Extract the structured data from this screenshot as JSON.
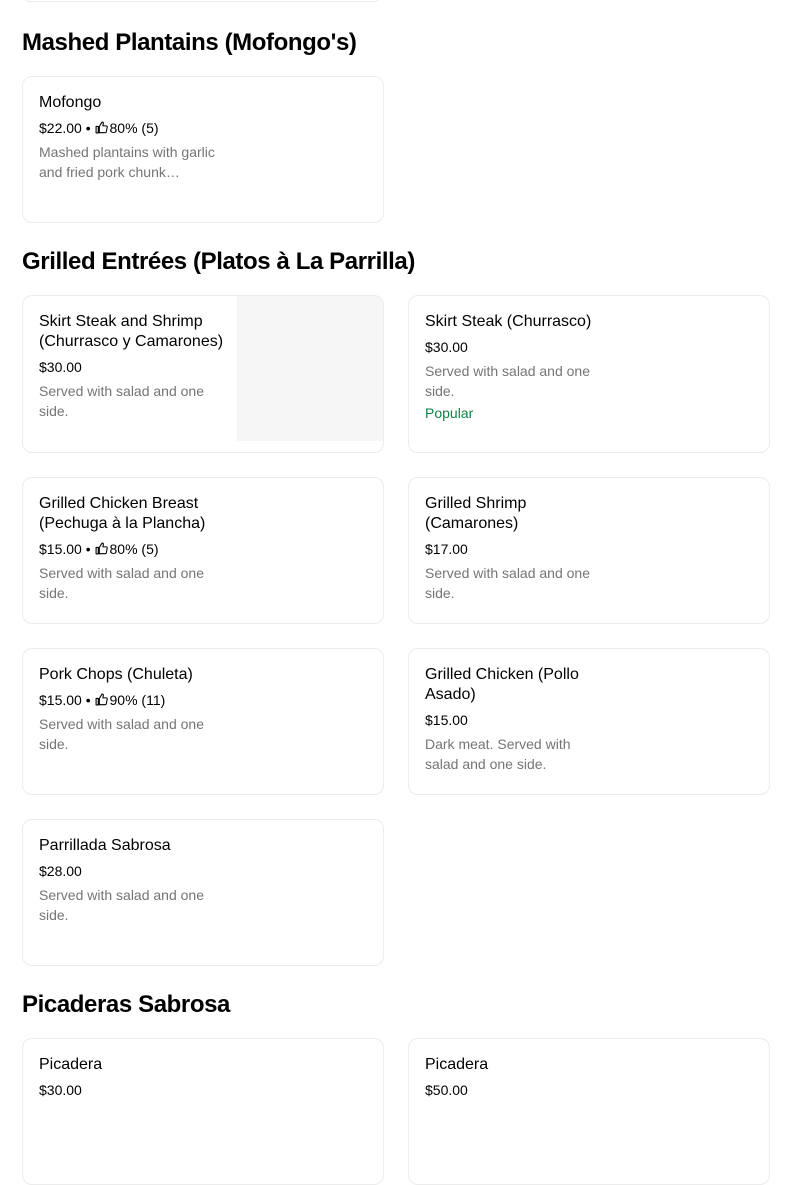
{
  "sections": [
    {
      "title": "Mashed Plantains (Mofongo's)",
      "items": [
        {
          "name": "Mofongo",
          "price": "$22.00",
          "rating": "80% (5)",
          "description": "Mashed plantains with garlic and fried pork chunk…",
          "badge": ""
        }
      ]
    },
    {
      "title": "Grilled Entrées (Platos à La Parrilla)",
      "items": [
        {
          "name": "Skirt Steak and Shrimp (Churrasco y Camarones)",
          "price": "$30.00",
          "rating": "",
          "description": "Served with salad and one side.",
          "badge": ""
        },
        {
          "name": "Skirt Steak (Churrasco)",
          "price": "$30.00",
          "rating": "",
          "description": "Served with salad and one side.",
          "badge": "Popular"
        },
        {
          "name": "Grilled Chicken Breast (Pechuga à la Plancha)",
          "price": "$15.00",
          "rating": "80% (5)",
          "description": "Served with salad and one side.",
          "badge": ""
        },
        {
          "name": "Grilled Shrimp (Camarones)",
          "price": "$17.00",
          "rating": "",
          "description": "Served with salad and one side.",
          "badge": ""
        },
        {
          "name": "Pork Chops (Chuleta)",
          "price": "$15.00",
          "rating": "90% (11)",
          "description": "Served with salad and one side.",
          "badge": ""
        },
        {
          "name": "Grilled Chicken (Pollo Asado)",
          "price": "$15.00",
          "rating": "",
          "description": "Dark meat. Served with salad and one side.",
          "badge": ""
        },
        {
          "name": "Parrillada Sabrosa",
          "price": "$28.00",
          "rating": "",
          "description": "Served with salad and one side.",
          "badge": ""
        }
      ]
    },
    {
      "title": "Picaderas Sabrosa",
      "items": [
        {
          "name": "Picadera",
          "price": "$30.00",
          "rating": "",
          "description": "",
          "badge": ""
        },
        {
          "name": "Picadera",
          "price": "$50.00",
          "rating": "",
          "description": "",
          "badge": ""
        }
      ]
    }
  ],
  "meta_separator": "•",
  "colors": {
    "border": "#ececec",
    "description_text": "#757575",
    "popular_badge": "#0e8345",
    "image_placeholder": "#f6f6f6"
  },
  "icons": {
    "rating": "thumbs-up-icon"
  }
}
